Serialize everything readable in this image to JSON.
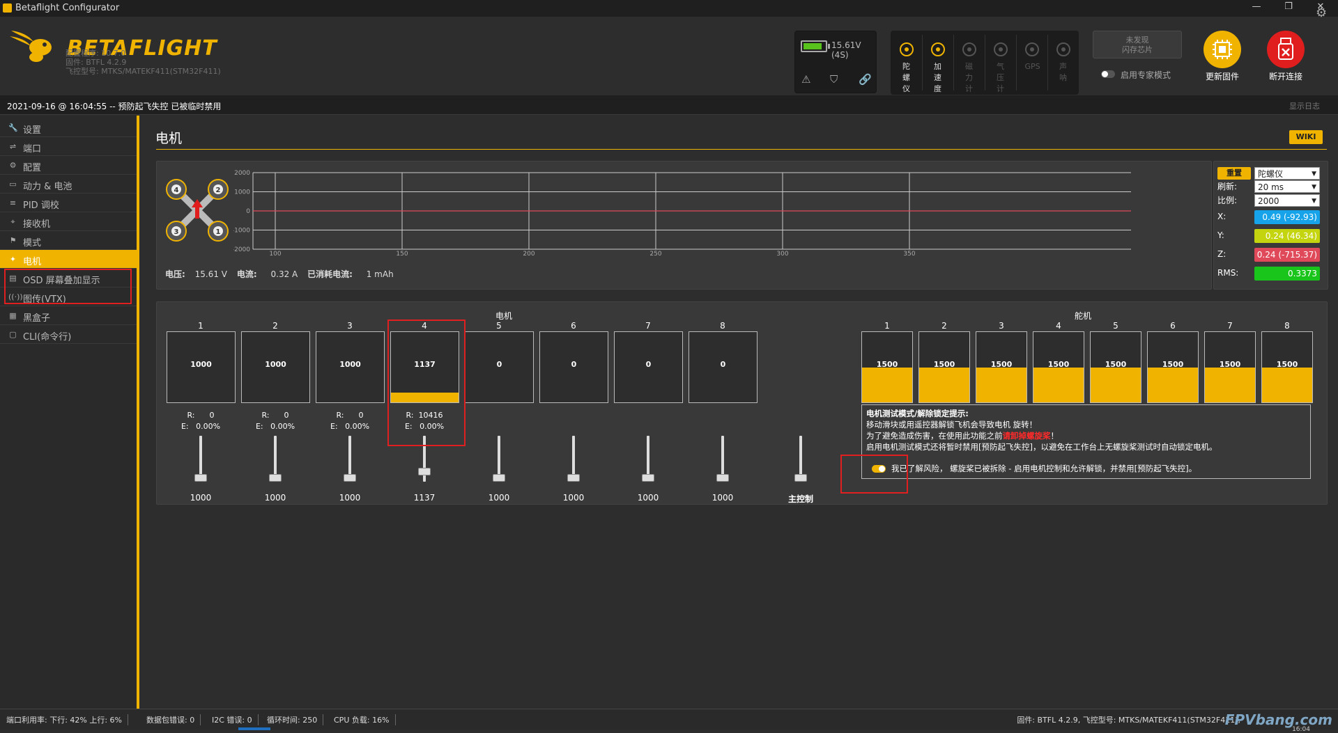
{
  "window": {
    "title": "Betaflight Configurator",
    "minimize": "—",
    "restore": "❐",
    "close": "✕"
  },
  "header": {
    "brand": "BETAFLIGHT",
    "configurator_version": "配置程序: 10.7.0",
    "firmware_version": "固件: BTFL 4.2.9",
    "board": "飞控型号: MTKS/MATEKF411(STM32F411)",
    "battery": {
      "voltage": "15.61V (4S)",
      "level": 0.8
    },
    "sensors": [
      {
        "label": "陀螺仪",
        "active": true,
        "icon": "gyro-icon"
      },
      {
        "label": "加速度计",
        "active": true,
        "icon": "accelerometer-icon"
      },
      {
        "label": "磁力计",
        "active": false,
        "icon": "compass-icon"
      },
      {
        "label": "气压计",
        "active": false,
        "icon": "barometer-icon"
      },
      {
        "label": "GPS",
        "active": false,
        "icon": "gps-icon"
      },
      {
        "label": "声呐",
        "active": false,
        "icon": "sonar-icon"
      }
    ],
    "flash_button": "未发现\n闪存芯片",
    "expert_mode": "启用专家模式",
    "update_firmware": "更新固件",
    "disconnect": "断开连接"
  },
  "status_line": {
    "text": "2021-09-16 @ 16:04:55 -- 预防起飞失控 已被临时禁用",
    "show_log": "显示日志"
  },
  "sidebar": {
    "items": [
      {
        "label": "设置",
        "icon": "wrench-icon"
      },
      {
        "label": "端口",
        "icon": "plug-icon"
      },
      {
        "label": "配置",
        "icon": "gear-icon"
      },
      {
        "label": "动力 & 电池",
        "icon": "battery-icon"
      },
      {
        "label": "PID 调校",
        "icon": "sliders-icon"
      },
      {
        "label": "接收机",
        "icon": "receiver-icon"
      },
      {
        "label": "模式",
        "icon": "modes-icon"
      },
      {
        "label": "电机",
        "icon": "motor-icon",
        "active": true
      },
      {
        "label": "OSD 屏幕叠加显示",
        "icon": "osd-icon"
      },
      {
        "label": "图传(VTX)",
        "icon": "vtx-icon"
      },
      {
        "label": "黑盒子",
        "icon": "blackbox-icon"
      },
      {
        "label": "CLI(命令行)",
        "icon": "cli-icon"
      }
    ]
  },
  "page": {
    "title": "电机",
    "wiki": "WIKI",
    "sensor_info": {
      "voltage_label": "电压:",
      "voltage": "15.61 V",
      "current_label": "电流:",
      "current": "0.32 A",
      "mah_label": "已消耗电流:",
      "mah": "1 mAh"
    },
    "controls": {
      "reset": "重置",
      "sensor_select": "陀螺仪",
      "refresh_label": "刷新:",
      "refresh": "20 ms",
      "scale_label": "比例:",
      "scale": "2000",
      "x_label": "X:",
      "x": "0.49 (-92.93)",
      "x_color": "#16a3ea",
      "y_label": "Y:",
      "y": "0.24 (46.34)",
      "y_color": "#c4d40f",
      "z_label": "Z:",
      "z": "0.24 (-715.37)",
      "z_color": "#e0495a",
      "rms_label": "RMS:",
      "rms": "0.3373",
      "rms_color": "#19c41b"
    },
    "motors_title": "电机",
    "servos_title": "舵机",
    "motors": [
      {
        "num": "1",
        "value": "1000",
        "r": "R:      0",
        "e": "E:   0.00%",
        "slider": "1000",
        "level": 0
      },
      {
        "num": "2",
        "value": "1000",
        "r": "R:      0",
        "e": "E:   0.00%",
        "slider": "1000",
        "level": 0
      },
      {
        "num": "3",
        "value": "1000",
        "r": "R:      0",
        "e": "E:   0.00%",
        "slider": "1000",
        "level": 0
      },
      {
        "num": "4",
        "value": "1137",
        "r": "R:  10416",
        "e": "E:   0.00%",
        "slider": "1137",
        "level": 0.137
      },
      {
        "num": "5",
        "value": "0",
        "r": "",
        "e": "",
        "slider": "1000",
        "level": 0
      },
      {
        "num": "6",
        "value": "0",
        "r": "",
        "e": "",
        "slider": "1000",
        "level": 0
      },
      {
        "num": "7",
        "value": "0",
        "r": "",
        "e": "",
        "slider": "1000",
        "level": 0
      },
      {
        "num": "8",
        "value": "0",
        "r": "",
        "e": "",
        "slider": "1000",
        "level": 0
      }
    ],
    "master_label": "主控制",
    "servos": [
      {
        "num": "1",
        "value": "1500"
      },
      {
        "num": "2",
        "value": "1500"
      },
      {
        "num": "3",
        "value": "1500"
      },
      {
        "num": "4",
        "value": "1500"
      },
      {
        "num": "5",
        "value": "1500"
      },
      {
        "num": "6",
        "value": "1500"
      },
      {
        "num": "7",
        "value": "1500"
      },
      {
        "num": "8",
        "value": "1500"
      }
    ],
    "warning": {
      "title": "电机测试模式/解除锁定提示:",
      "line1": "移动滑块或用遥控器解锁飞机会导致电机 旋转！",
      "line2a": "为了避免造成伤害，在使用此功能之前",
      "line2b": "请卸掉螺旋桨",
      "line2c": "！",
      "line3": "启用电机测试模式还将暂时禁用[预防起飞失控]，以避免在工作台上无螺旋桨测试时自动锁定电机。",
      "accept": "我已了解风险， 螺旋桨已被拆除 - 启用电机控制和允许解锁，并禁用[预防起飞失控]。"
    },
    "graph": {
      "y_ticks": [
        "2000",
        "1000",
        "0",
        "-1000",
        "-2000"
      ],
      "x_ticks": [
        "100",
        "150",
        "200",
        "250",
        "300",
        "350"
      ]
    }
  },
  "footer": {
    "port_util": "端口利用率:   下行: 42% 上行: 6%",
    "packet_error": "数据包错误: 0",
    "i2c_error": "I2C 错误: 0",
    "cycle_time": "循环时间: 250",
    "cpu_load": "CPU 负载: 16%",
    "firmware": "固件: BTFL 4.2.9, 飞控型号: MTKS/MATEKF411(STM32F411),",
    "watermark": "FPVbang.com",
    "clock": "16:04"
  }
}
